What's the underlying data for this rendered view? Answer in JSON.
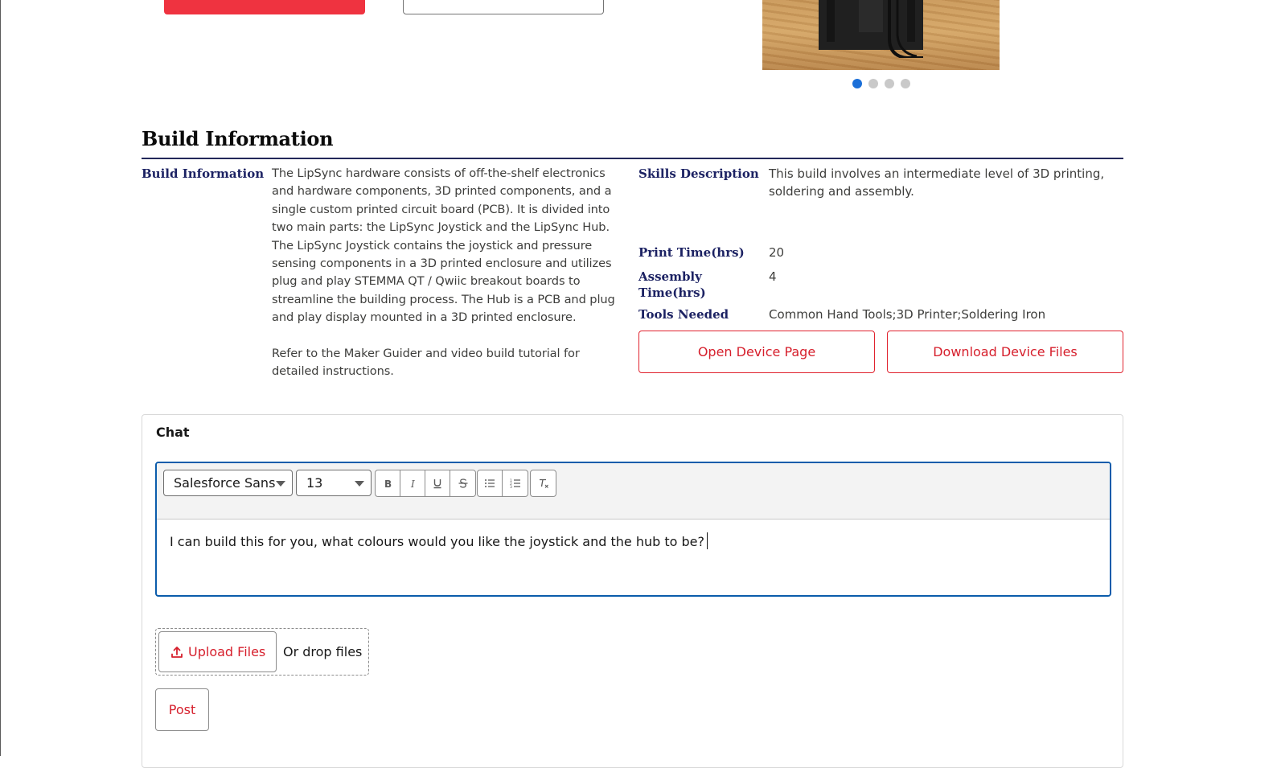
{
  "carousel": {
    "slide_count": 4,
    "active_index": 0
  },
  "build_info": {
    "section_title": "Build Information",
    "description_label": "Build Information",
    "description_paragraphs": [
      "The LipSync hardware consists of off-the-shelf electronics and hardware components, 3D printed components, and a single custom printed circuit board (PCB). It is divided into two main parts: the LipSync Joystick and the LipSync Hub. The LipSync Joystick contains the joystick and pressure sensing components in a 3D printed enclosure and utilizes plug and play STEMMA QT / Qwiic breakout boards to streamline the building process. The Hub is a PCB and plug and play display mounted in a 3D printed enclosure.",
      "Refer to the Maker Guider and video build tutorial for detailed instructions."
    ],
    "skills_label": "Skills Description",
    "skills_value": "This build involves an intermediate level of 3D printing, soldering and assembly.",
    "print_time_label": "Print Time(hrs)",
    "print_time_value": "20",
    "assembly_time_label": "Assembly Time(hrs)",
    "assembly_time_value": "4",
    "tools_label": "Tools Needed",
    "tools_value": "Common Hand Tools;3D Printer;Soldering Iron",
    "open_device_label": "Open Device Page",
    "download_files_label": "Download Device Files"
  },
  "chat": {
    "title": "Chat",
    "font_family_value": "Salesforce Sans",
    "font_size_value": "13",
    "toolbar_icons": [
      "bold-icon",
      "italic-icon",
      "underline-icon",
      "strikethrough-icon",
      "bulleted-list-icon",
      "numbered-list-icon",
      "clear-formatting-icon"
    ],
    "message_text": "I can build this for you, what colours would you like the joystick and the hub to be?",
    "upload_label": "Upload Files",
    "drop_text": "Or drop files",
    "post_label": "Post"
  },
  "colors": {
    "brand_red": "#ef3340",
    "link_red": "#d61f2c",
    "heading_navy": "#1c2263",
    "focus_blue": "#0b5cab",
    "active_dot": "#1b6fd8"
  }
}
